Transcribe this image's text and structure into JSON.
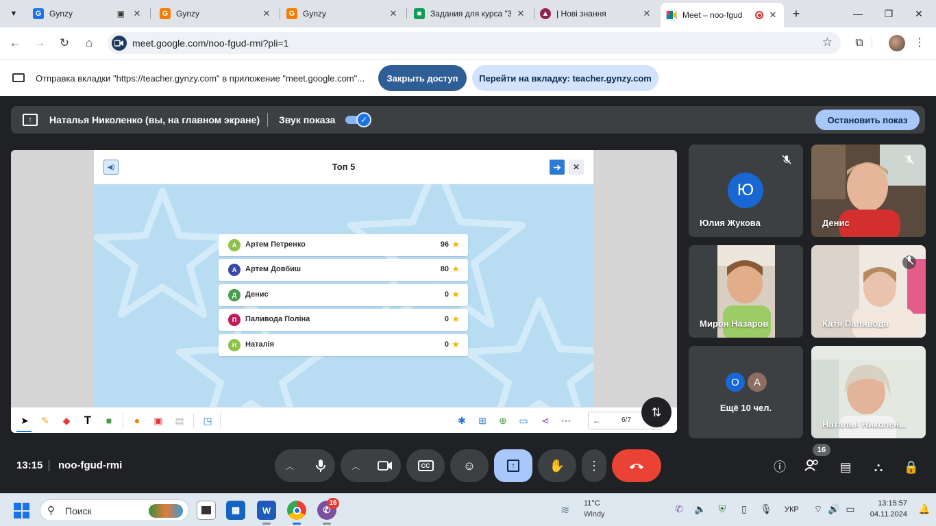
{
  "browser": {
    "tabs": [
      {
        "title": "Gynzy",
        "favicon": "G",
        "color": "#1a73e8"
      },
      {
        "title": "Gynzy",
        "favicon": "G",
        "color": "#f57c00"
      },
      {
        "title": "Gynzy",
        "favicon": "G",
        "color": "#f57c00"
      },
      {
        "title": "Задания для курса \"3",
        "favicon": "classroom",
        "color": "#0f9d58"
      },
      {
        "title": "| Нові знання",
        "favicon": "hat",
        "color": "#8e244d"
      },
      {
        "title": "Meet – noo-fgud",
        "favicon": "meet",
        "color": "#00897b"
      }
    ],
    "new_tab": "+",
    "url": "meet.google.com/noo-fgud-rmi?pli=1"
  },
  "infobar": {
    "message": "Отправка вкладки \"https://teacher.gynzy.com\" в приложение \"meet.google.com\"...",
    "stop_access": "Закрыть доступ",
    "goto_tab": "Перейти на вкладку: teacher.gynzy.com"
  },
  "present_bar": {
    "presenter": "Наталья Николенко (вы, на главном экране)",
    "audio_label": "Звук показа",
    "stop_label": "Остановить показ"
  },
  "slide": {
    "title": "Топ 5",
    "leaderboard": [
      {
        "initial": "А",
        "name": "Артем Петренко",
        "score": "96",
        "color": "#8bc34a"
      },
      {
        "initial": "А",
        "name": "Артем Довбиш",
        "score": "80",
        "color": "#3949ab"
      },
      {
        "initial": "Д",
        "name": "Денис",
        "score": "0",
        "color": "#43a047"
      },
      {
        "initial": "П",
        "name": "Паливода Поліна",
        "score": "0",
        "color": "#c2185b"
      },
      {
        "initial": "Н",
        "name": "Наталія",
        "score": "0",
        "color": "#8bc34a"
      }
    ],
    "page": "6/7"
  },
  "participants": [
    {
      "name": "Юлия Жукова",
      "initial": "Ю"
    },
    {
      "name": "Денис"
    },
    {
      "name": "Мирон Назаров"
    },
    {
      "name": "Катя Паливода"
    },
    {
      "name": "Ещё 10 чел.",
      "initials": [
        "О",
        "А"
      ]
    },
    {
      "name": "Наталья Николен..."
    }
  ],
  "meeting": {
    "time": "13:15",
    "code": "noo-fgud-rmi",
    "participant_count": "16"
  },
  "taskbar": {
    "search": "Поиск",
    "viber_badge": "16",
    "temp": "11°C",
    "weather": "Windy",
    "lang": "УКР",
    "time": "13:15:57",
    "date": "04.11.2024"
  }
}
